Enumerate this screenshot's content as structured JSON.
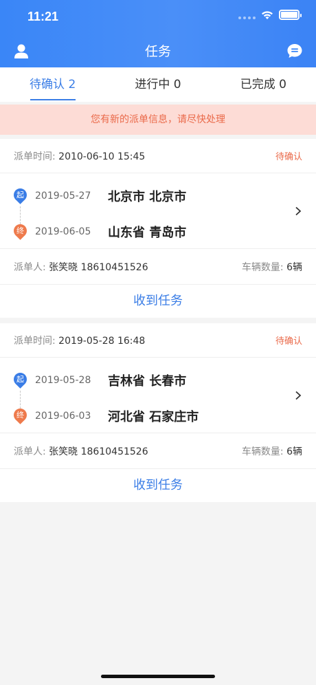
{
  "status_bar": {
    "time": "11:21"
  },
  "nav": {
    "title": "任务",
    "user_icon": "user-icon",
    "message_icon": "message-icon"
  },
  "tabs": [
    {
      "label": "待确认 2",
      "active": true
    },
    {
      "label": "进行中 0",
      "active": false
    },
    {
      "label": "已完成 0",
      "active": false
    }
  ],
  "notice": "您有新的派单信息，请尽快处理",
  "cards": [
    {
      "dispatch_label": "派单时间:",
      "dispatch_time": "2010-06-10 15:45",
      "status": "待确认",
      "start_pin": "起",
      "start_date": "2019-05-27",
      "start_city": "北京市 北京市",
      "end_pin": "终",
      "end_date": "2019-06-05",
      "end_city": "山东省 青岛市",
      "dispatcher_label": "派单人:",
      "dispatcher": "张笑晓 18610451526",
      "vehicles_label": "车辆数量:",
      "vehicles": "6辆",
      "action": "收到任务"
    },
    {
      "dispatch_label": "派单时间:",
      "dispatch_time": "2019-05-28 16:48",
      "status": "待确认",
      "start_pin": "起",
      "start_date": "2019-05-28",
      "start_city": "吉林省 长春市",
      "end_pin": "终",
      "end_date": "2019-06-03",
      "end_city": "河北省 石家庄市",
      "dispatcher_label": "派单人:",
      "dispatcher": "张笑晓 18610451526",
      "vehicles_label": "车辆数量:",
      "vehicles": "6辆",
      "action": "收到任务"
    }
  ],
  "colors": {
    "primary": "#3a7de6",
    "accent": "#ea6a4a",
    "notice_bg": "#fddcd6"
  }
}
